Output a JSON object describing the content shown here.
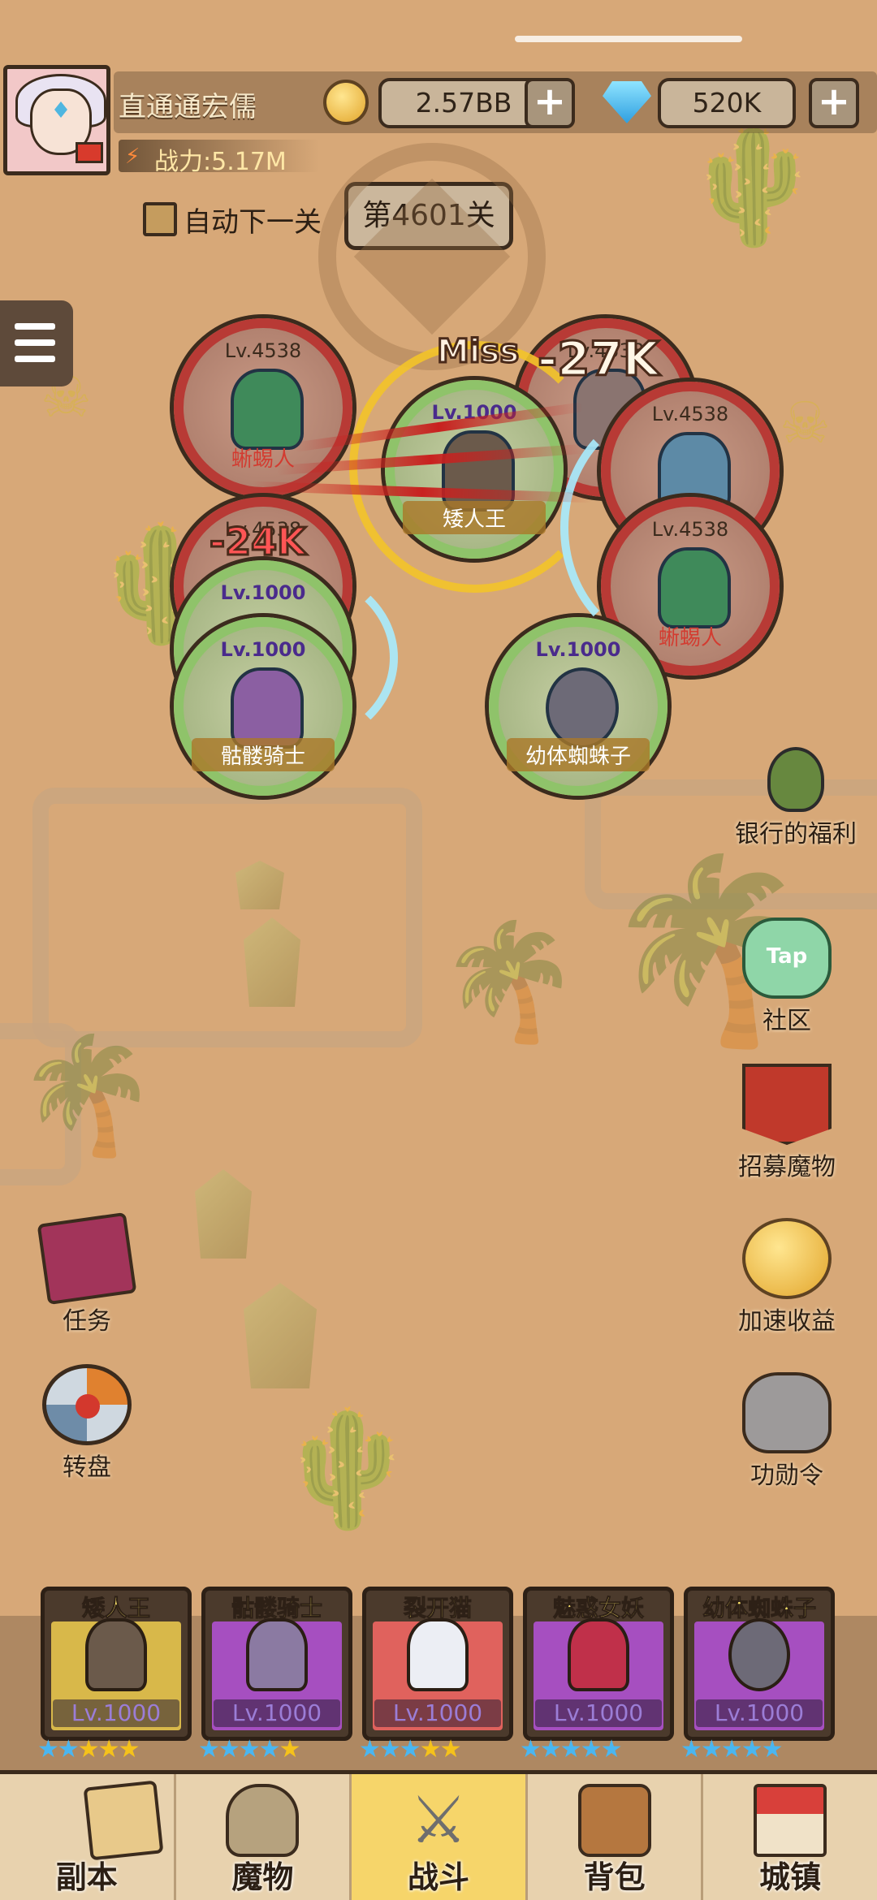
{
  "player": {
    "name": "直通通宏儒",
    "power": "战力:5.17M"
  },
  "currency": {
    "gold": "2.57BB",
    "diamonds": "520K"
  },
  "stage": {
    "auto_next_label": "自动下一关",
    "current": "第4601关"
  },
  "battle": {
    "enemies": [
      {
        "level": "Lv.4538",
        "name": "蜥蜴人"
      },
      {
        "level": "Lv.4538",
        "name": ""
      },
      {
        "level": "Lv.4538",
        "name": ""
      },
      {
        "level": "Lv.4538",
        "name": ""
      },
      {
        "level": "Lv.4538",
        "name": "蜥蜴人"
      }
    ],
    "allies": [
      {
        "level": "Lv.1000",
        "name": "矮人王"
      },
      {
        "level": "Lv.1000",
        "name": ""
      },
      {
        "level": "Lv.1000",
        "name": "骷髅骑士"
      },
      {
        "level": "Lv.1000",
        "name": "幼体蜘蛛子"
      }
    ],
    "damage_texts": [
      "Miss",
      "-27K",
      "-24K"
    ]
  },
  "side_buttons": {
    "bank": "银行的福利",
    "community": "社区",
    "community_icon_text": "Tap",
    "recruit": "招募魔物",
    "speed_income": "加速收益",
    "merit": "功勋令",
    "tasks": "任务",
    "wheel": "转盘"
  },
  "team": [
    {
      "name": "矮人王",
      "level": "Lv.1000",
      "stars": 5,
      "color": "#d8b84a"
    },
    {
      "name": "骷髅骑士",
      "level": "Lv.1000",
      "stars": 5,
      "color": "#a64fc0"
    },
    {
      "name": "裂开猫",
      "level": "Lv.1000",
      "stars": 5,
      "color": "#e0625d"
    },
    {
      "name": "魅惑女妖",
      "level": "Lv.1000",
      "stars": 5,
      "color": "#a64fc0"
    },
    {
      "name": "幼体蜘蛛子",
      "level": "Lv.1000",
      "stars": 5,
      "color": "#a64fc0"
    }
  ],
  "nav": {
    "items": [
      {
        "label": "副本",
        "icon": "map-icon"
      },
      {
        "label": "魔物",
        "icon": "monster-helmet-icon"
      },
      {
        "label": "战斗",
        "icon": "crossed-swords-icon",
        "active": true
      },
      {
        "label": "背包",
        "icon": "backpack-icon"
      },
      {
        "label": "城镇",
        "icon": "shop-icon"
      }
    ]
  },
  "colors": {
    "accent": "#f6d56a",
    "enemy_ring": "#b83a35",
    "ally_ring": "#8fc36a",
    "star_blue": "#4ab6f0",
    "star_gold": "#f5c21b"
  }
}
